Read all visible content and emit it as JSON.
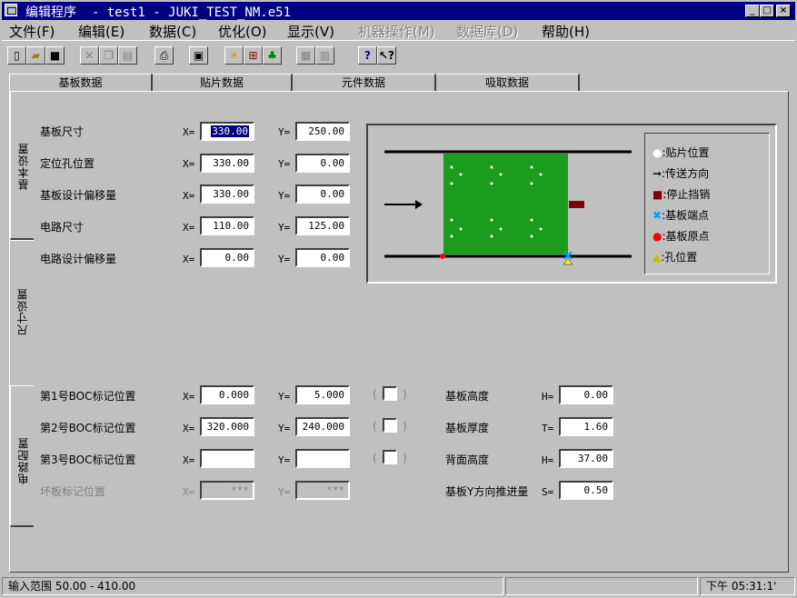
{
  "window": {
    "title": "编辑程序  - test1 - JUKI_TEST_NM.e51",
    "minimize": "_",
    "maximize": "□",
    "close": "×"
  },
  "menu": [
    {
      "label": "文件(F)",
      "disabled": false
    },
    {
      "label": "编辑(E)",
      "disabled": false
    },
    {
      "label": "数据(C)",
      "disabled": false
    },
    {
      "label": "优化(O)",
      "disabled": false
    },
    {
      "label": "显示(V)",
      "disabled": false
    },
    {
      "label": "机器操作(M)",
      "disabled": true
    },
    {
      "label": "数据库(D)",
      "disabled": true
    },
    {
      "label": "帮助(H)",
      "disabled": false
    }
  ],
  "toolbar": [
    {
      "icon": "new-file-icon",
      "glyph": "▯"
    },
    {
      "icon": "open-folder-icon",
      "glyph": "▰"
    },
    {
      "icon": "save-icon",
      "glyph": "■"
    },
    {
      "icon": "cut-icon",
      "glyph": "✕"
    },
    {
      "icon": "copy-icon",
      "glyph": "❐"
    },
    {
      "icon": "paste-icon",
      "glyph": "▤"
    },
    {
      "icon": "print-icon",
      "glyph": "⎙"
    },
    {
      "icon": "find-icon",
      "glyph": "▣"
    },
    {
      "icon": "optimize-bulb-icon",
      "glyph": "☀"
    },
    {
      "icon": "network-icon",
      "glyph": "⊞"
    },
    {
      "icon": "components-icon",
      "glyph": "♣"
    },
    {
      "icon": "board-view-icon",
      "glyph": "▦"
    },
    {
      "icon": "board-view-2-icon",
      "glyph": "▥"
    },
    {
      "icon": "help-icon",
      "glyph": "?"
    },
    {
      "icon": "context-help-icon",
      "glyph": "↖?"
    }
  ],
  "tabs": [
    "基板数据",
    "贴片数据",
    "元件数据",
    "吸取数据"
  ],
  "side_tabs": [
    "基本设置",
    "尺寸设置",
    "电路配置"
  ],
  "board": {
    "rows": [
      {
        "label": "基板尺寸",
        "x": "330.00",
        "y": "250.00",
        "disabled": false
      },
      {
        "label": "定位孔位置",
        "x": "330.00",
        "y": "0.00",
        "disabled": false
      },
      {
        "label": "基板设计偏移量",
        "x": "330.00",
        "y": "0.00",
        "disabled": false
      },
      {
        "label": "电路尺寸",
        "x": "110.00",
        "y": "125.00",
        "disabled": false
      },
      {
        "label": "电路设计偏移量",
        "x": "0.00",
        "y": "0.00",
        "disabled": false
      }
    ],
    "x_prefix": "X=",
    "y_prefix": "Y="
  },
  "marks": {
    "rows": [
      {
        "label": "第1号BOC标记位置",
        "x": "0.000",
        "y": "5.000",
        "disabled": false,
        "check": true
      },
      {
        "label": "第2号BOC标记位置",
        "x": "320.000",
        "y": "240.000",
        "disabled": false,
        "check": true
      },
      {
        "label": "第3号BOC标记位置",
        "x": "",
        "y": "",
        "disabled": false,
        "check": true
      },
      {
        "label": "坏板标记位置",
        "x": "***",
        "y": "***",
        "disabled": true,
        "check": false
      }
    ],
    "paren_open": "(",
    "paren_close": ")"
  },
  "heights": [
    {
      "label": "基板高度",
      "prefix": "H=",
      "value": "0.00"
    },
    {
      "label": "基板厚度",
      "prefix": "T=",
      "value": "1.60"
    },
    {
      "label": "背面高度",
      "prefix": "H=",
      "value": "37.00"
    },
    {
      "label": "基板Y方向推进量",
      "prefix": "S=",
      "value": "0.50"
    }
  ],
  "legend": [
    {
      "icon": "placement-dot-icon",
      "text": ":贴片位置",
      "color": "#ffffff"
    },
    {
      "icon": "arrow-right-icon",
      "text": ":传送方向",
      "color": "#000000"
    },
    {
      "icon": "stopper-square-icon",
      "text": ":停止挡销",
      "color": "#800000"
    },
    {
      "icon": "board-end-x-icon",
      "text": ":基板端点",
      "color": "#00a0ff"
    },
    {
      "icon": "board-origin-dot-icon",
      "text": ":基板原点",
      "color": "#ff0000"
    },
    {
      "icon": "hole-triangle-icon",
      "text": ":孔位置",
      "color": "#ffff00"
    }
  ],
  "colors": {
    "board_green": "#1c9c1c",
    "title_blue": "#000080",
    "stopper": "#800000"
  },
  "status": {
    "input_range": "输入范围  50.00 - 410.00",
    "time": "下午 05:31:1'"
  }
}
